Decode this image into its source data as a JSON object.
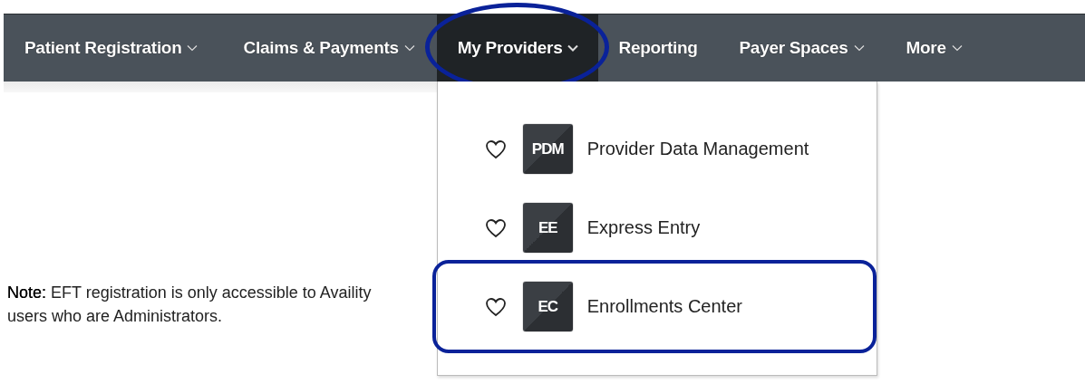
{
  "nav": {
    "items": [
      {
        "label": "Patient Registration",
        "has_menu": true,
        "selected": false,
        "highlighted": false
      },
      {
        "label": "Claims & Payments",
        "has_menu": true,
        "selected": false,
        "highlighted": false
      },
      {
        "label": "My Providers",
        "has_menu": true,
        "selected": true,
        "highlighted": true
      },
      {
        "label": "Reporting",
        "has_menu": false,
        "selected": false,
        "highlighted": false
      },
      {
        "label": "Payer Spaces",
        "has_menu": true,
        "selected": false,
        "highlighted": false
      },
      {
        "label": "More",
        "has_menu": true,
        "selected": false,
        "highlighted": false
      }
    ]
  },
  "dropdown": {
    "items": [
      {
        "tile": "PDM",
        "label": "Provider Data Management",
        "favorite": false,
        "highlighted": false
      },
      {
        "tile": "EE",
        "label": "Express Entry",
        "favorite": false,
        "highlighted": false
      },
      {
        "tile": "EC",
        "label": "Enrollments Center",
        "favorite": false,
        "highlighted": true
      }
    ]
  },
  "note": "**Note:**  EFT registration is only accessible to Availity users who are Administrators."
}
